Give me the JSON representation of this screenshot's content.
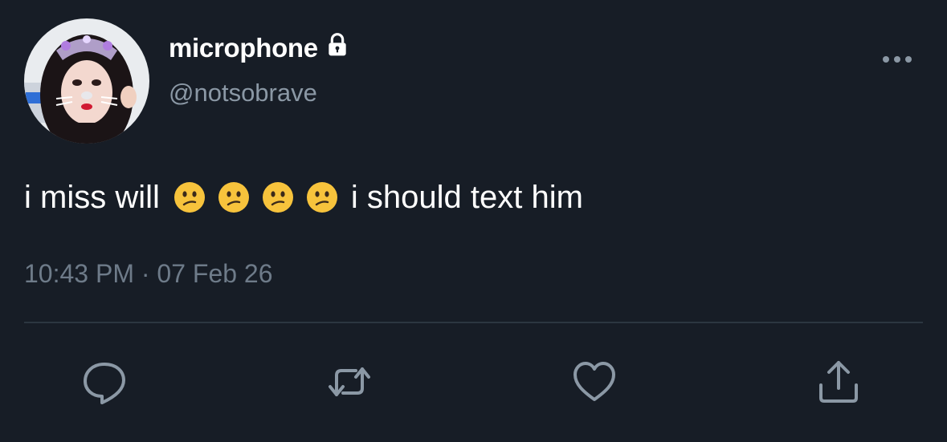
{
  "tweet": {
    "display_name": "microphone",
    "handle": "@notsobrave",
    "text_before": "i miss will",
    "emojis": [
      "confused-face",
      "confused-face",
      "confused-face",
      "confused-face"
    ],
    "text_after": "i should text him",
    "time": "10:43 PM",
    "separator": "·",
    "date": "07 Feb 26"
  },
  "icons": {
    "lock": "lock-icon",
    "more": "more-dots-icon",
    "reply": "reply-icon",
    "retweet": "retweet-icon",
    "like": "heart-icon",
    "share": "share-icon"
  },
  "colors": {
    "background": "#171d26",
    "text": "#ffffff",
    "secondary": "#8b98a5",
    "icon": "#8b98a5",
    "divider": "#2c3640"
  }
}
